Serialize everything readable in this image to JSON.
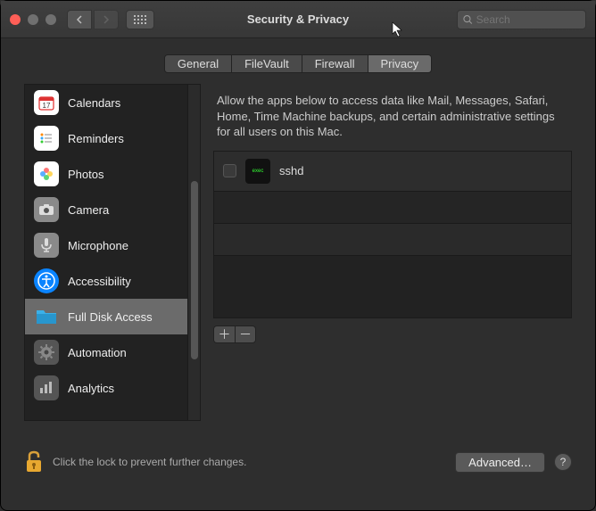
{
  "window": {
    "title": "Security & Privacy"
  },
  "search": {
    "placeholder": "Search"
  },
  "tabs": [
    "General",
    "FileVault",
    "Firewall",
    "Privacy"
  ],
  "active_tab": 3,
  "sidebar": {
    "items": [
      {
        "label": "Calendars",
        "icon": "calendar-icon"
      },
      {
        "label": "Reminders",
        "icon": "reminders-icon"
      },
      {
        "label": "Photos",
        "icon": "photos-icon"
      },
      {
        "label": "Camera",
        "icon": "camera-icon"
      },
      {
        "label": "Microphone",
        "icon": "microphone-icon"
      },
      {
        "label": "Accessibility",
        "icon": "accessibility-icon"
      },
      {
        "label": "Full Disk Access",
        "icon": "folder-icon"
      },
      {
        "label": "Automation",
        "icon": "gear-icon"
      },
      {
        "label": "Analytics",
        "icon": "analytics-icon"
      }
    ],
    "selected": 6
  },
  "description": "Allow the apps below to access data like Mail, Messages, Safari, Home, Time Machine backups, and certain administrative settings for all users on this Mac.",
  "apps": [
    {
      "name": "sshd",
      "checked": false
    }
  ],
  "footer": {
    "lock_text": "Click the lock to prevent further changes.",
    "advanced": "Advanced…",
    "help": "?"
  },
  "buttons": {
    "add": "＋",
    "remove": "－"
  }
}
